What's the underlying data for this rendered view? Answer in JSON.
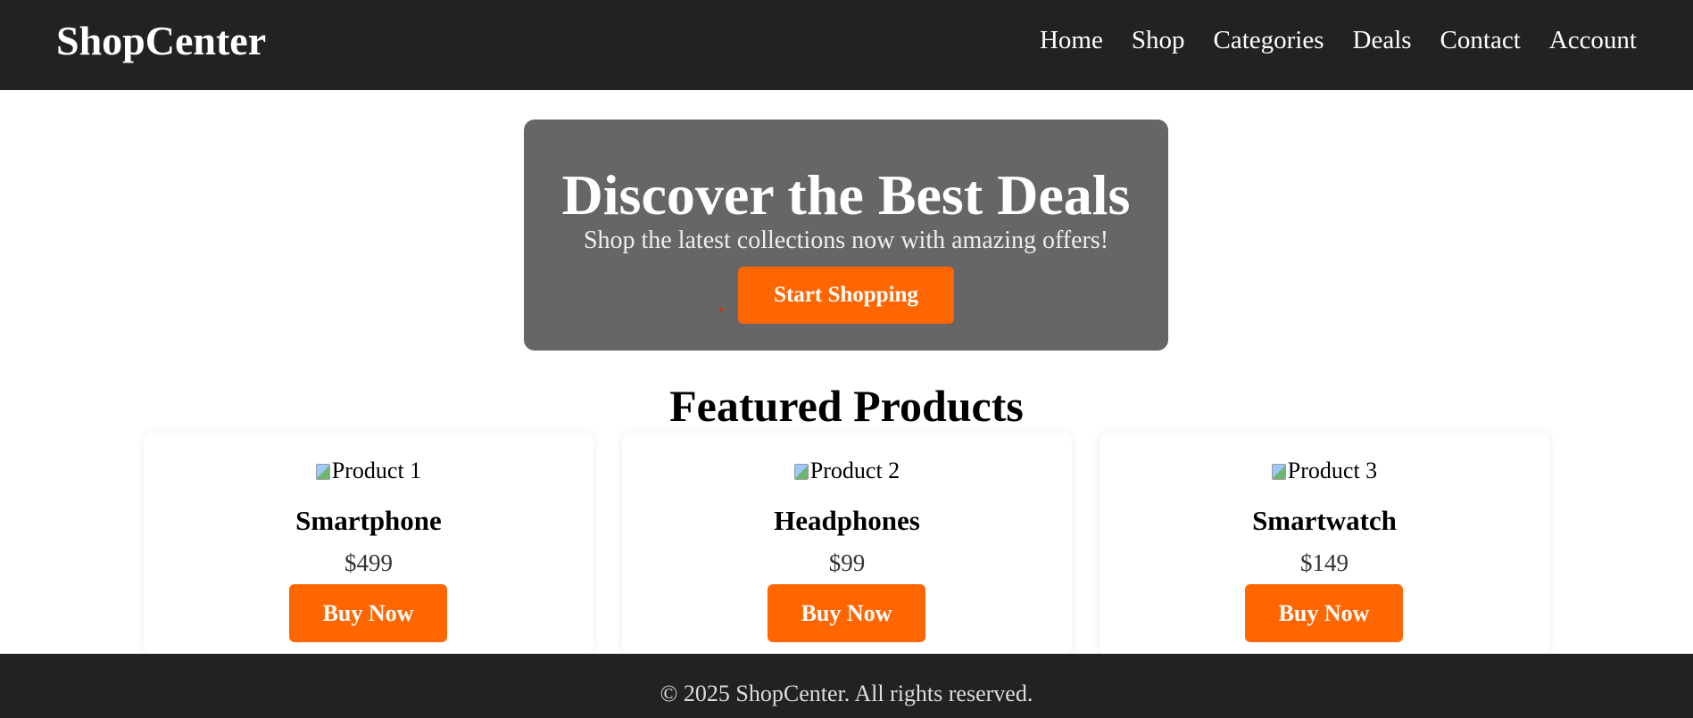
{
  "header": {
    "logo": "ShopCenter",
    "nav": [
      {
        "label": "Home"
      },
      {
        "label": "Shop"
      },
      {
        "label": "Categories"
      },
      {
        "label": "Deals"
      },
      {
        "label": "Contact"
      },
      {
        "label": "Account"
      }
    ]
  },
  "hero": {
    "title": "Discover the Best Deals",
    "subtitle": "Shop the latest collections now with amazing offers!",
    "cta_label": "Start Shopping"
  },
  "featured": {
    "title": "Featured Products",
    "products": [
      {
        "image_alt": "Product 1",
        "name": "Smartphone",
        "price": "$499",
        "button_label": "Buy Now"
      },
      {
        "image_alt": "Product 2",
        "name": "Headphones",
        "price": "$99",
        "button_label": "Buy Now"
      },
      {
        "image_alt": "Product 3",
        "name": "Smartwatch",
        "price": "$149",
        "button_label": "Buy Now"
      }
    ]
  },
  "footer": {
    "text": "© 2025 ShopCenter. All rights reserved."
  },
  "colors": {
    "header_bg": "#222222",
    "hero_bg": "#666666",
    "accent": "#ff6600",
    "footer_bg": "#222222"
  },
  "icons": {
    "broken_image": "broken-image-icon"
  }
}
